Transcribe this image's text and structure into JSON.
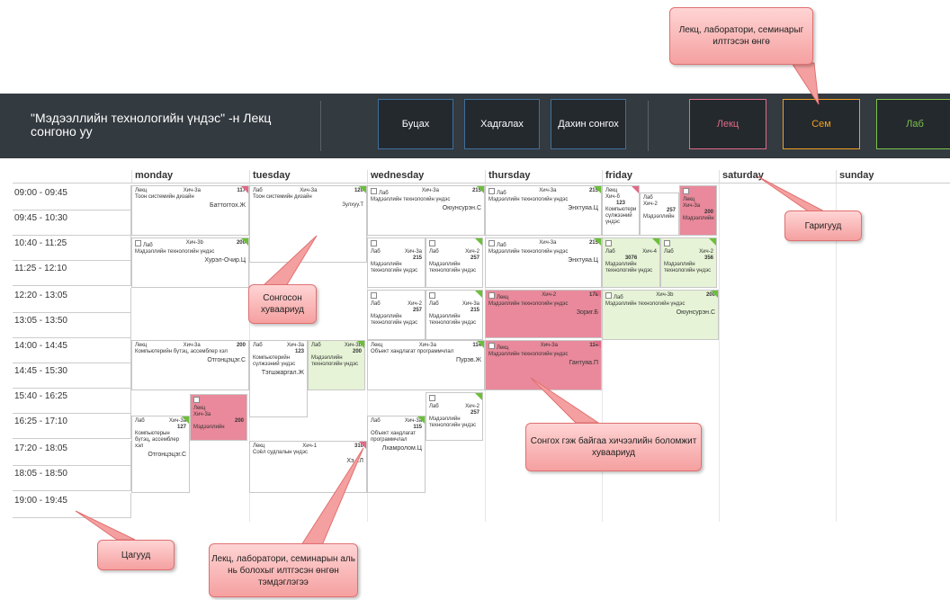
{
  "header": {
    "title": "\"Мэдээллийн технологийн үндэс\" -н Лекц сонгоно уу",
    "buttons": {
      "back": "Буцах",
      "save": "Хадгалах",
      "reselect": "Дахин сонгох"
    },
    "type_buttons": {
      "lecture": {
        "label": "Лекц",
        "color": "#e26a86"
      },
      "seminar": {
        "label": "Сем",
        "color": "#f0a020"
      },
      "lab": {
        "label": "Лаб",
        "color": "#7cc24a"
      }
    }
  },
  "days": [
    "monday",
    "tuesday",
    "wednesday",
    "thursday",
    "friday",
    "saturday",
    "sunday"
  ],
  "times": [
    "09:00 - 09:45",
    "09:45 - 10:30",
    "10:40 - 11:25",
    "11:25 - 12:10",
    "12:20 - 13:05",
    "13:05 - 13:50",
    "14:00 - 14:45",
    "14:45 - 15:30",
    "15:40 - 16:25",
    "16:25 - 17:10",
    "17:20 - 18:05",
    "18:05 - 18:50",
    "19:00 - 19:45"
  ],
  "events": {
    "mon1": {
      "type": "Лекц",
      "group": "Хич-3а",
      "room": "117",
      "subject": "Тоон системийн дизайн",
      "teacher": "Баттогтох.Ж"
    },
    "mon2": {
      "type": "Лаб",
      "group": "Хич-3b",
      "room": "200",
      "subject": "Мэдээллийн технологийн үндэс",
      "teacher": "Хурэл-Очир.Ц"
    },
    "mon3": {
      "type": "Лекц",
      "group": "Хич-3а",
      "room": "200",
      "subject": "Компьютерийн бүтэц, ассемблер хэл",
      "teacher": "Отгонцэцэг.С"
    },
    "mon4": {
      "type": "Лаб",
      "group": "Хич-3а",
      "room": "127",
      "subject": "Компьютерын бүтэц, ассемблер хэл",
      "teacher": "Отгонцэцэг.С"
    },
    "mon5": {
      "type": "Лекц",
      "group": "Хич-3а",
      "room": "200",
      "subject": "Мэдээллийн"
    },
    "tue1": {
      "type": "Лаб",
      "group": "Хич-3а",
      "room": "120",
      "subject": "Тоон системийн дизайн",
      "teacher": "Зулхуу.Т"
    },
    "tue2": {
      "type": "Лаб",
      "group": "Хич-3а",
      "room": "123",
      "subject": "Компьютерийн сүлжээний үндэс",
      "teacher": "Тэгшжаргал.Ж"
    },
    "tue3": {
      "type": "Лаб",
      "group": "Хич-3b",
      "room": "200",
      "subject": "Мэдээллийн технологийн үндэс"
    },
    "tue4": {
      "type": "Лекц",
      "group": "Хич-1",
      "room": "310",
      "subject": "Соёл судлалын үндэс",
      "teacher": "Хэ...Л"
    },
    "wed1": {
      "type": "Лаб",
      "group": "Хич-3а",
      "room": "215",
      "subject": "Мэдээллийн технологийн үндэс",
      "teacher": "Оюунсурэн.С"
    },
    "wed2": {
      "type": "Лаб",
      "group": "Хич-3а",
      "room": "215",
      "subject": "Мэдээллийн технологийн үндэс"
    },
    "wed3": {
      "type": "Лаб",
      "group": "Хич-2",
      "room": "257",
      "subject": "Мэдээллийн технологийн үндэс"
    },
    "wed4": {
      "type": "Лаб",
      "group": "Хич-2",
      "room": "257",
      "subject": "Мэдээллийн технологийн үндэс"
    },
    "wed5": {
      "type": "Лаб",
      "group": "Хич-3а",
      "room": "215",
      "subject": "Мэдээллийн технологийн үндэс"
    },
    "wed6": {
      "type": "Лекц",
      "group": "Хич-3а",
      "room": "114",
      "subject": "Объект хандлагат программчлал",
      "teacher": "Пурэв.Ж"
    },
    "wed7": {
      "type": "Лаб",
      "group": "Хич-2",
      "room": "257",
      "subject": "Мэдээллийн технологийн үндэс"
    },
    "wed8": {
      "type": "Лаб",
      "group": "Хич-3а",
      "room": "115",
      "subject": "Объект хандлагат программчлал",
      "teacher": "Лхамролом.Ц"
    },
    "thu1": {
      "type": "Лаб",
      "group": "Хич-3а",
      "room": "215",
      "subject": "Мэдээллийн технологийн үндэс",
      "teacher": "Энхтуяа.Ц"
    },
    "thu2": {
      "type": "Лаб",
      "group": "Хич-3а",
      "room": "215",
      "subject": "Мэдээллийн технологийн үндэс",
      "teacher": "Энхтуяа.Ц"
    },
    "thu3": {
      "type": "Лекц",
      "group": "Хич-2",
      "room": "178",
      "subject": "Мэдээллийн технологийн үндэс",
      "teacher": "Зориг.Б"
    },
    "thu4": {
      "type": "Лекц",
      "group": "Хич-3а",
      "room": "114",
      "subject": "Мэдээллийн технологийн үндэс",
      "teacher": "Гантуяа.П"
    },
    "fri1": {
      "type": "Лекц",
      "group": "Хич-б",
      "room": "123",
      "subject": "Компьютери сүлжээний үндэс"
    },
    "fri2": {
      "type": "Лаб",
      "group": "Хич-2",
      "room": "257",
      "subject": "Мэдээллийн"
    },
    "fri3": {
      "type": "Лекц",
      "group": "Хич-3а",
      "room": "200",
      "subject": "Мэдээллийн"
    },
    "fri4": {
      "type": "Лаб",
      "group": "Хич-4",
      "room": "3076",
      "subject": "Мэдээллийн технологийн үндэс"
    },
    "fri5": {
      "type": "Лаб",
      "group": "Хич-2",
      "room": "356",
      "subject": "Мэдээллийн технологийн үндэс"
    },
    "fri6": {
      "type": "Лаб",
      "group": "Хич-3b",
      "room": "200",
      "subject": "Мэдээллийн технологийн үндэс",
      "teacher": "Оюунсурэн.С"
    }
  },
  "callouts": {
    "colors": "Лекц, лаборатори, семинарыг илтгэсэн өнгө",
    "selected": "Сонгосон хуваариуд",
    "titles": "Гаригууд",
    "options": "Сонгох гэж байгаа хичээлийн боломжит хуваариуд",
    "times": "Цагууд",
    "marker": "Лекц, лаборатори, семинарын аль нь болохыг илтгэсэн өнгөн тэмдэглэгээ"
  }
}
